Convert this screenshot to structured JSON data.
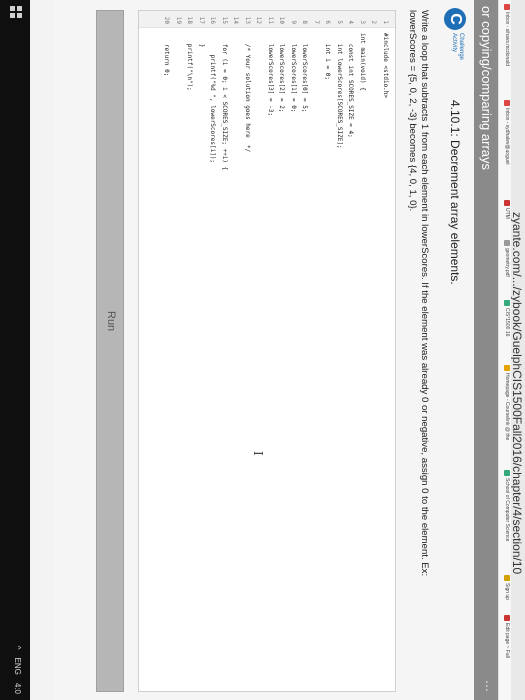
{
  "browser": {
    "url": "zyante.com/.../zybook/GuelphCIS1500Fall2016/chapter/4/section/10",
    "bookmarks": [
      "Inbox - sihavs.mcdonald",
      "Inbox - sydhalev@uoguel",
      "UTM",
      "geometry.pdf",
      "CIS*1500 16",
      "Homepage - Courselink @ the",
      "School of Computer Science",
      "Sign up",
      "Edit page ~ Fall"
    ]
  },
  "page": {
    "header_title": "or copying/comparing arrays",
    "more_glyph": "⋯"
  },
  "activity": {
    "badge_letter": "C",
    "badge_label_line1": "Challenge",
    "badge_label_line2": "Activity",
    "title": "4.10.1: Decrement array elements.",
    "description_line1": "Write a loop that subtracts 1 from each element in lowerScores. If the element was already 0 or negative, assign 0 to the element. Ex:",
    "description_line2": "lowerScores = {5, 0, 2, -3} becomes {4, 0, 1, 0}."
  },
  "code_editor": {
    "lines": [
      {
        "num": "1",
        "text": "#include <stdio.h>"
      },
      {
        "num": "2",
        "text": ""
      },
      {
        "num": "3",
        "text": "int main(void) {"
      },
      {
        "num": "4",
        "text": "   const int SCORES_SIZE = 4;"
      },
      {
        "num": "5",
        "text": "   int lowerScores[SCORES_SIZE];"
      },
      {
        "num": "6",
        "text": "   int i = 0;"
      },
      {
        "num": "7",
        "text": ""
      },
      {
        "num": "8",
        "text": "   lowerScores[0] = 5;"
      },
      {
        "num": "9",
        "text": "   lowerScores[1] = 0;"
      },
      {
        "num": "10",
        "text": "   lowerScores[2] = 2;"
      },
      {
        "num": "11",
        "text": "   lowerScores[3] = -3;"
      },
      {
        "num": "12",
        "text": ""
      },
      {
        "num": "13",
        "text": "   /* Your solution goes here  */"
      },
      {
        "num": "14",
        "text": ""
      },
      {
        "num": "15",
        "text": "   for (i = 0; i < SCORES_SIZE; ++i) {"
      },
      {
        "num": "16",
        "text": "      printf(\"%d \", lowerScores[i]);"
      },
      {
        "num": "17",
        "text": "   }"
      },
      {
        "num": "18",
        "text": "   printf(\"\\n\");"
      },
      {
        "num": "19",
        "text": ""
      },
      {
        "num": "20",
        "text": "   return 0;"
      }
    ]
  },
  "run_button_label": "Run",
  "taskbar": {
    "tray_items": [
      "^",
      "ENG",
      "4:0"
    ]
  },
  "colors": {
    "accent": "#1e6fb5",
    "header_band": "#8a8a8a",
    "run_button": "#b6b6b6"
  }
}
